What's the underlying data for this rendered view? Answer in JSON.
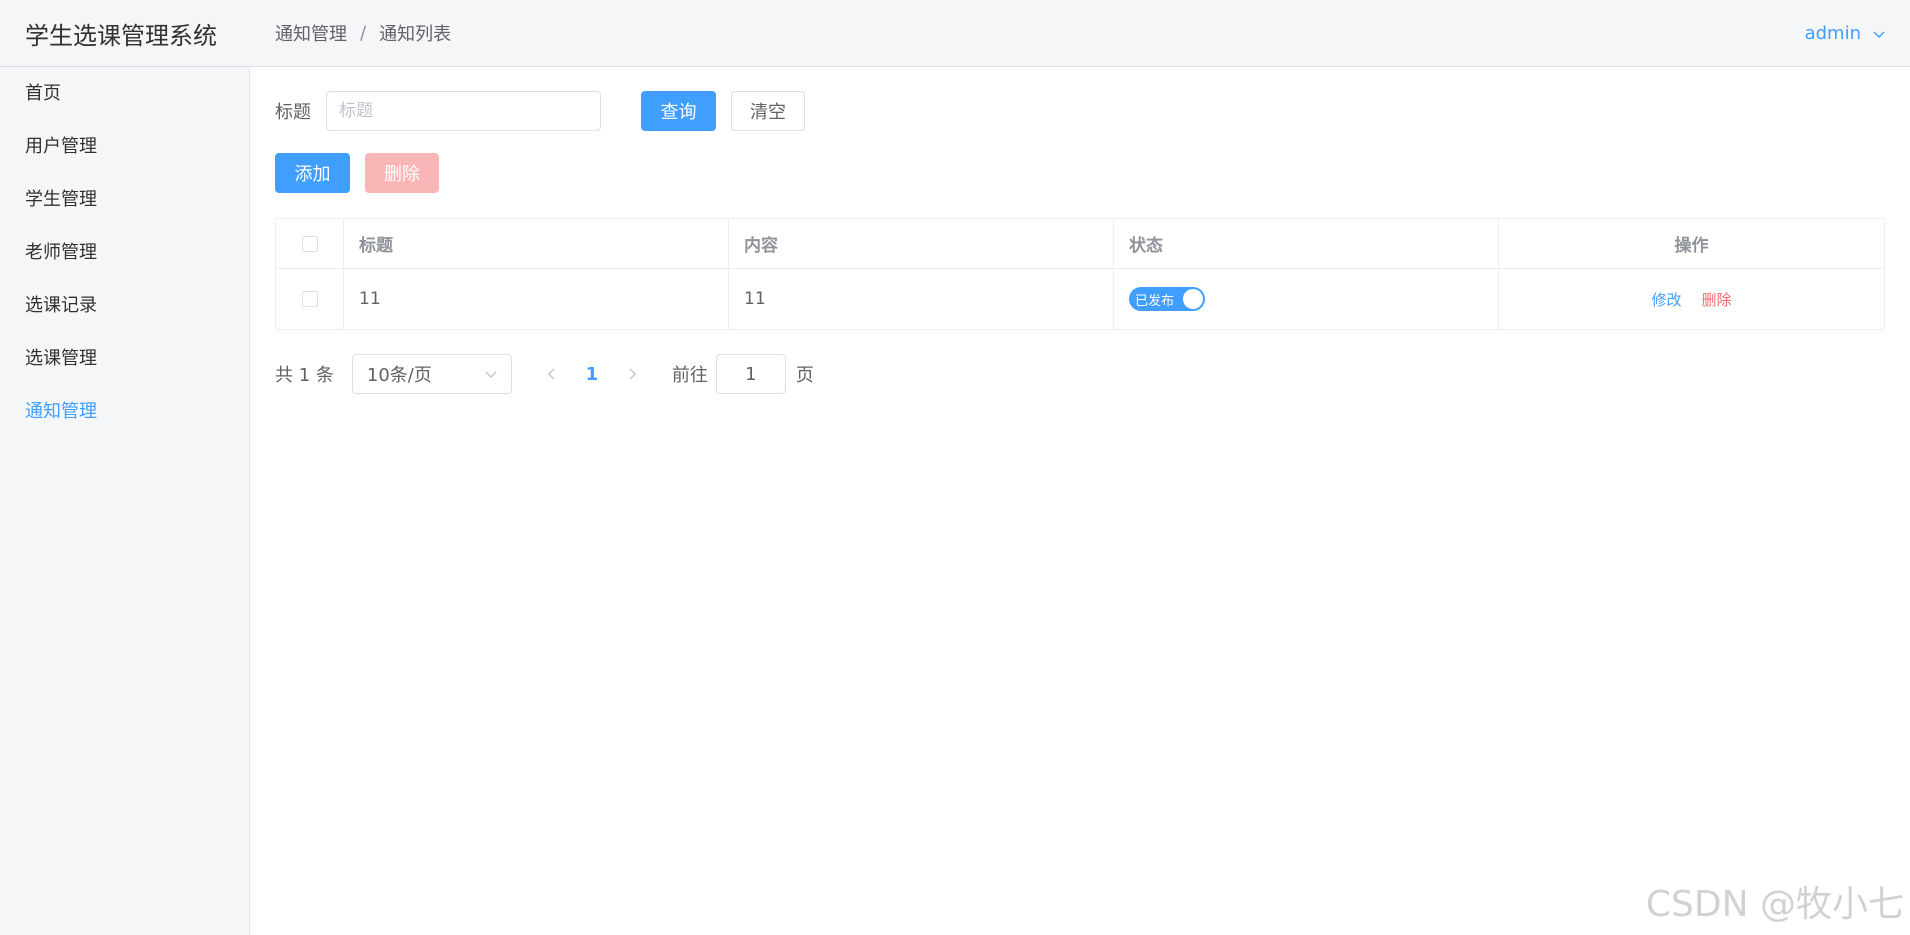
{
  "app": {
    "title": "学生选课管理系统"
  },
  "breadcrumb": {
    "items": [
      "通知管理",
      "通知列表"
    ],
    "separator": "/"
  },
  "user": {
    "name": "admin"
  },
  "sidebar": {
    "items": [
      {
        "label": "首页"
      },
      {
        "label": "用户管理"
      },
      {
        "label": "学生管理"
      },
      {
        "label": "老师管理"
      },
      {
        "label": "选课记录"
      },
      {
        "label": "选课管理"
      },
      {
        "label": "通知管理"
      }
    ],
    "active": "通知管理"
  },
  "search": {
    "label": "标题",
    "placeholder": "标题",
    "value": "",
    "query_label": "查询",
    "clear_label": "清空"
  },
  "actions": {
    "add_label": "添加",
    "delete_label": "删除"
  },
  "table": {
    "columns": [
      "标题",
      "内容",
      "状态",
      "操作"
    ],
    "rows": [
      {
        "title": "11",
        "content": "11",
        "status_label": "已发布",
        "status_on": true,
        "edit_label": "修改",
        "delete_label": "删除"
      }
    ]
  },
  "pagination": {
    "total_text": "共 1 条",
    "page_size": "10条/页",
    "current_page": "1",
    "goto_label": "前往",
    "goto_value": "1",
    "goto_suffix": "页"
  },
  "watermark": {
    "text": "CSDN @牧小七"
  },
  "colors": {
    "primary": "#409eff",
    "danger": "#f56c6c",
    "danger_disabled": "#fab6b6",
    "sidebar_bg": "#f5f6f8"
  }
}
